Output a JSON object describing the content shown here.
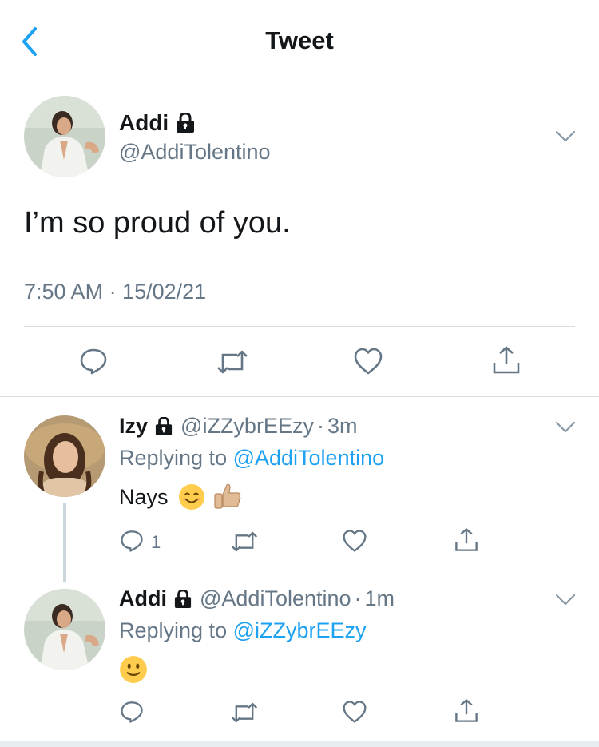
{
  "nav": {
    "title": "Tweet"
  },
  "main_tweet": {
    "name": "Addi",
    "handle": "@AddiTolentino",
    "text": "I’m so proud of you.",
    "timestamp": "7:50 AM · 15/02/21"
  },
  "replies": [
    {
      "name": "Izy",
      "handle": "@iZZybrEEzy",
      "dot": "·",
      "time": "3m",
      "replying_prefix": "Replying to ",
      "replying_to": "@AddiTolentino",
      "text": "Nays",
      "emojis": [
        "smiling-face-emoji",
        "thumbs-up-emoji"
      ],
      "reply_count": "1"
    },
    {
      "name": "Addi",
      "handle": "@AddiTolentino",
      "dot": "·",
      "time": "1m",
      "replying_prefix": "Replying to ",
      "replying_to": "@iZZybrEEzy",
      "text": "",
      "emojis": [
        "slightly-smiling-face-emoji"
      ],
      "reply_count": ""
    }
  ],
  "colors": {
    "accent": "#1da1f2",
    "secondary_text": "#657786",
    "divider": "#d8dde1",
    "text": "#14171a"
  },
  "icons": [
    "back-icon",
    "lock-icon",
    "chevron-down-icon",
    "reply-icon",
    "retweet-icon",
    "like-icon",
    "share-icon"
  ]
}
